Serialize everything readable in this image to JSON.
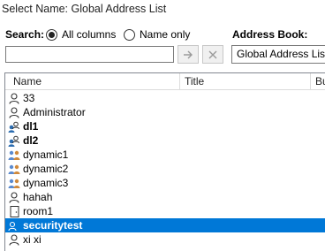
{
  "window": {
    "title": "Select Name: Global Address List"
  },
  "search": {
    "label": "Search:",
    "option_all": "All columns",
    "option_name": "Name only",
    "input_value": ""
  },
  "address_book": {
    "label": "Address Book:",
    "selected": "Global Address List"
  },
  "columns": [
    "Name",
    "Title",
    "Bu"
  ],
  "rows": [
    {
      "name": "33",
      "icon": "person-icon",
      "bold": false,
      "selected": false
    },
    {
      "name": "Administrator",
      "icon": "person-icon",
      "bold": false,
      "selected": false
    },
    {
      "name": "dl1",
      "icon": "distribution-list-icon",
      "bold": true,
      "selected": false
    },
    {
      "name": "dl2",
      "icon": "distribution-list-icon",
      "bold": true,
      "selected": false
    },
    {
      "name": "dynamic1",
      "icon": "dynamic-group-icon",
      "bold": false,
      "selected": false
    },
    {
      "name": "dynamic2",
      "icon": "dynamic-group-icon",
      "bold": false,
      "selected": false
    },
    {
      "name": "dynamic3",
      "icon": "dynamic-group-icon",
      "bold": false,
      "selected": false
    },
    {
      "name": "hahah",
      "icon": "person-icon",
      "bold": false,
      "selected": false
    },
    {
      "name": "room1",
      "icon": "room-icon",
      "bold": false,
      "selected": false
    },
    {
      "name": "securitytest",
      "icon": "distribution-list-icon",
      "bold": true,
      "selected": true
    },
    {
      "name": "xi xi",
      "icon": "person-icon",
      "bold": false,
      "selected": false
    }
  ]
}
